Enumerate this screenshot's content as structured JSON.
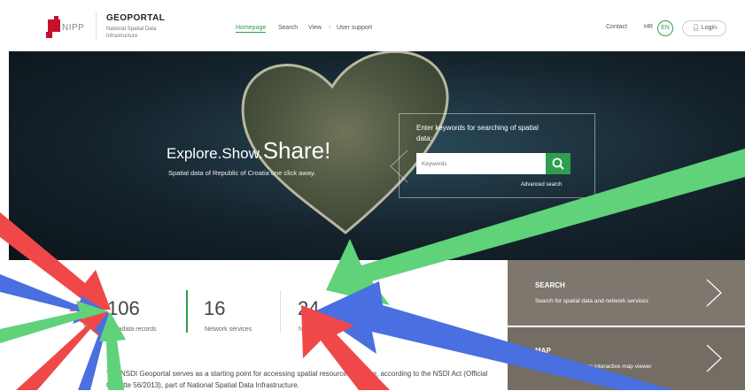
{
  "header": {
    "brand_title": "GEOPORTAL",
    "brand_subtitle": "National Spatial Data Infrastructure",
    "logo_text": "NIPP",
    "nav": [
      "Homepage",
      "Search",
      "View",
      "User support"
    ],
    "contact": "Contact",
    "lang_hr": "HR",
    "lang_en": "EN",
    "login": "Login"
  },
  "hero": {
    "title_part1": "Explore.",
    "title_part2": "Show.",
    "title_part3": "Share!",
    "subtitle": "Spatial data of Republic of Croatia one click away.",
    "search_label": "Enter keywords for searching of spatial data:",
    "search_placeholder": "Keywords",
    "advanced_search": "Advanced search"
  },
  "stats": [
    {
      "number": "106",
      "label": "Metadata records"
    },
    {
      "number": "16",
      "label": "Network services"
    },
    {
      "number": "24",
      "label": "NSDI subjects"
    }
  ],
  "description": "The NSDI Geoportal serves as a starting point for accessing spatial resources that are, according to the NSDI Act (Official Gazette 56/2013), part of National Spatial Data Infrastructure.",
  "panels": [
    {
      "title": "SEARCH",
      "desc": "Search for spatial data and network services"
    },
    {
      "title": "MAP",
      "desc": "Spatial data view in an interactive map viewer"
    }
  ],
  "colors": {
    "accent": "#2e9e4f",
    "brand_red": "#c8102e",
    "panel_bg": "#7d776e"
  }
}
